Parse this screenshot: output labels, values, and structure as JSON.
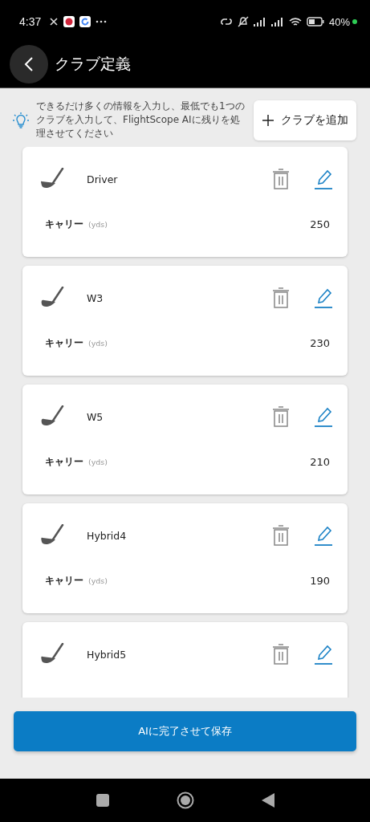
{
  "status_bar": {
    "time": "4:37",
    "battery": "40%"
  },
  "header": {
    "title": "クラブ定義"
  },
  "info": {
    "text": "できるだけ多くの情報を入力し、最低でも1つのクラブを入力して、FlightScope AIに残りを処理させてください",
    "add_button": "クラブを追加"
  },
  "clubs": [
    {
      "name": "Driver",
      "kind": "driver",
      "carry_label": "キャリー",
      "unit": "(yds)",
      "carry": "250"
    },
    {
      "name": "W3",
      "kind": "wood",
      "carry_label": "キャリー",
      "unit": "(yds)",
      "carry": "230"
    },
    {
      "name": "W5",
      "kind": "wood",
      "carry_label": "キャリー",
      "unit": "(yds)",
      "carry": "210"
    },
    {
      "name": "Hybrid4",
      "kind": "hybrid",
      "carry_label": "キャリー",
      "unit": "(yds)",
      "carry": "190"
    },
    {
      "name": "Hybrid5",
      "kind": "hybrid"
    }
  ],
  "save_button": "AIに完了させて保存"
}
